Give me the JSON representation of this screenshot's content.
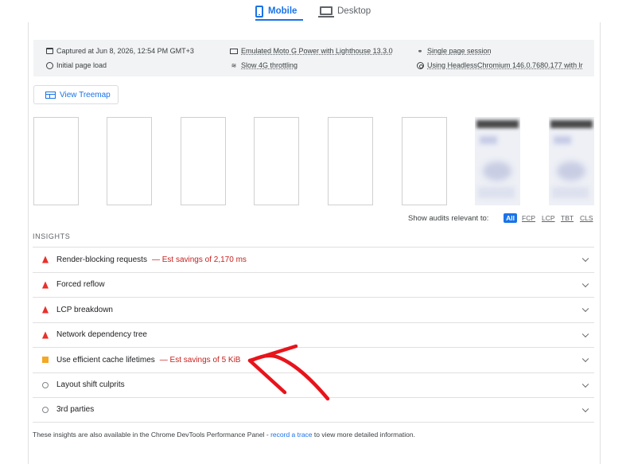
{
  "tabs": [
    {
      "label": "Mobile",
      "icon": "phone-icon",
      "active": true
    },
    {
      "label": "Desktop",
      "icon": "laptop-icon",
      "active": false
    }
  ],
  "meta": {
    "captured": "Captured at Jun 8, 2026, 12:54 PM GMT+3",
    "load": "Initial page load",
    "device": "Emulated Moto G Power with Lighthouse 13.3.0",
    "throttling": "Slow 4G throttling",
    "session": "Single page session",
    "browser": "Using HeadlessChromium 146.0.7680.177 with lr"
  },
  "treemap_button": "View Treemap",
  "audit_filter": {
    "label": "Show audits relevant to:",
    "options": [
      "All",
      "FCP",
      "LCP",
      "TBT",
      "CLS"
    ],
    "selected": "All"
  },
  "insights": {
    "title": "INSIGHTS",
    "items": [
      {
        "title": "Render-blocking requests",
        "savings": "— Est savings of 2,170 ms",
        "severity": "fail"
      },
      {
        "title": "Forced reflow",
        "savings": "",
        "severity": "fail"
      },
      {
        "title": "LCP breakdown",
        "savings": "",
        "severity": "fail"
      },
      {
        "title": "Network dependency tree",
        "savings": "",
        "severity": "fail"
      },
      {
        "title": "Use efficient cache lifetimes",
        "savings": "— Est savings of 5 KiB",
        "severity": "average"
      },
      {
        "title": "Layout shift culprits",
        "savings": "",
        "severity": "info"
      },
      {
        "title": "3rd parties",
        "savings": "",
        "severity": "info"
      }
    ]
  },
  "footnote": {
    "before": "These insights are also available in the Chrome DevTools Performance Panel - ",
    "link": "record a trace",
    "after": " to view more detailed information."
  },
  "colors": {
    "accent": "#1a73e8",
    "fail": "#e8302a",
    "average": "#f4a825",
    "savings": "#c5221f",
    "annotation_arrow": "#e8141b"
  }
}
